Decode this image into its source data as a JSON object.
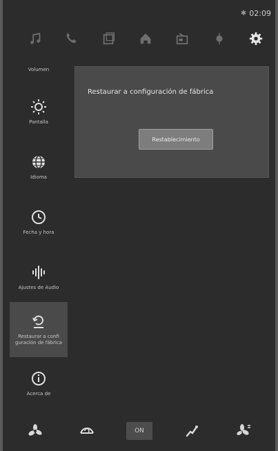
{
  "status": {
    "time": "02:09",
    "bluetooth": "bluetooth-icon"
  },
  "topbar": {
    "icons": [
      "music-icon",
      "phone-icon",
      "apps-icon",
      "home-icon",
      "radio-icon",
      "navigation-icon",
      "settings-icon"
    ]
  },
  "sidebar": {
    "header": "Volumen",
    "items": [
      {
        "label": "Pantalla",
        "icon": "brightness-icon"
      },
      {
        "label": "Idioma",
        "icon": "globe-icon"
      },
      {
        "label": "Fecha y hora",
        "icon": "clock-icon"
      },
      {
        "label": "Ajustes de Audio",
        "icon": "audio-wave-icon"
      },
      {
        "label": "Restaurar a confi guración de fábrica",
        "icon": "factory-reset-icon",
        "active": true
      },
      {
        "label": "Acerca de",
        "icon": "info-icon"
      }
    ]
  },
  "panel": {
    "title": "Restaurar a configuración de fábrica",
    "button_label": "Restablecimiento"
  },
  "bottombar": {
    "items": [
      "fan-icon",
      "recirculation-icon",
      "on-button",
      "seat-heat-icon",
      "fan-speed-icon"
    ],
    "on_label": "ON"
  },
  "colors": {
    "background": "#2c2c2c",
    "panel": "#4a4a4a",
    "button": "#7d7d7d",
    "active_item": "#4a4a4a"
  }
}
